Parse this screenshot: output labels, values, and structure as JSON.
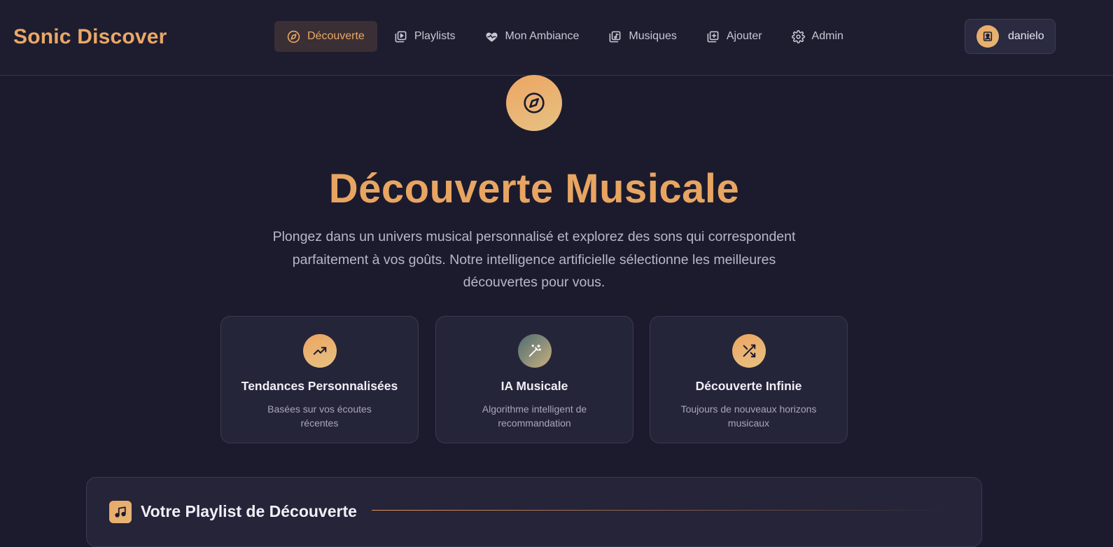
{
  "brand": "Sonic Discover",
  "nav": [
    {
      "label": "Découverte",
      "icon": "compass-icon",
      "active": true
    },
    {
      "label": "Playlists",
      "icon": "playlist-play-icon",
      "active": false
    },
    {
      "label": "Mon Ambiance",
      "icon": "heart-pulse-icon",
      "active": false
    },
    {
      "label": "Musiques",
      "icon": "music-library-icon",
      "active": false
    },
    {
      "label": "Ajouter",
      "icon": "add-square-icon",
      "active": false
    },
    {
      "label": "Admin",
      "icon": "gear-icon",
      "active": false
    }
  ],
  "user": {
    "name": "danielo",
    "icon": "user-icon"
  },
  "hero": {
    "icon": "compass-icon",
    "title": "Découverte Musicale",
    "subtitle": "Plongez dans un univers musical personnalisé et explorez des sons qui correspondent parfaitement à vos goûts. Notre intelligence artificielle sélectionne les meilleures découvertes pour vous."
  },
  "features": [
    {
      "title": "Tendances Personnalisées",
      "description": "Basées sur vos écoutes récentes",
      "icon": "trending-up-icon"
    },
    {
      "title": "IA Musicale",
      "description": "Algorithme intelligent de recommandation",
      "icon": "magic-wand-icon"
    },
    {
      "title": "Découverte Infinie",
      "description": "Toujours de nouveaux horizons musicaux",
      "icon": "shuffle-icon"
    }
  ],
  "playlist": {
    "title": "Votre Playlist de Découverte",
    "icon": "music-note-icon"
  },
  "colors": {
    "accent": "#eaa866",
    "background": "#1c1b2e",
    "card": "#25253a"
  }
}
